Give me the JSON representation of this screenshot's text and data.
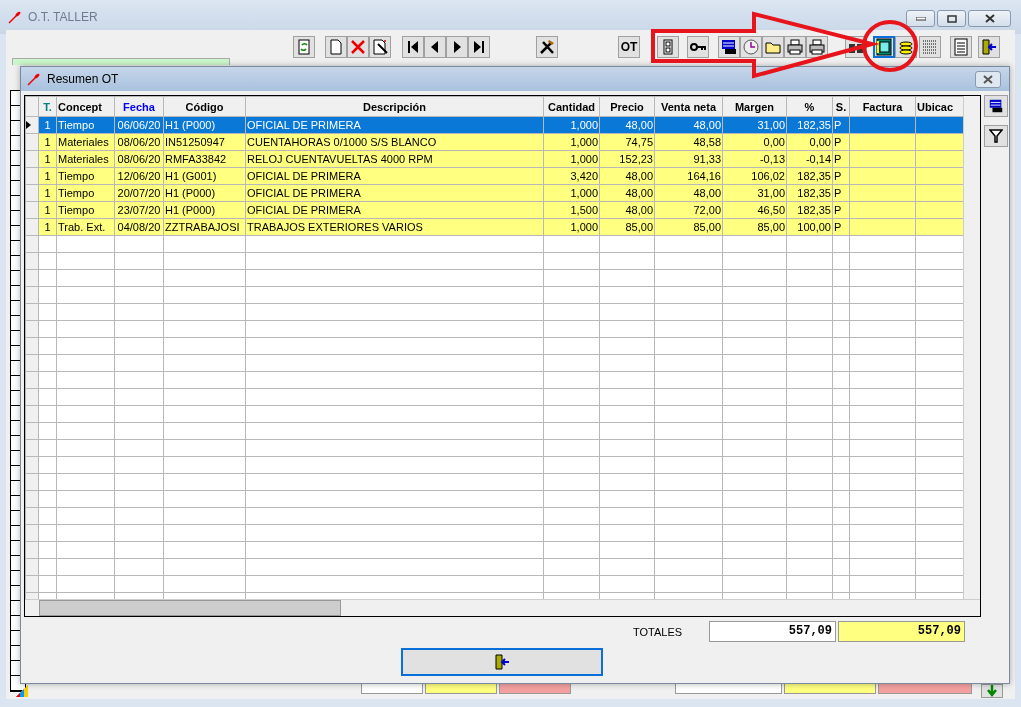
{
  "window": {
    "title": "O.T. TALLER"
  },
  "toolbar": [
    {
      "kind": "refresh",
      "selected": false
    },
    {
      "kind": "new",
      "selected": false
    },
    {
      "kind": "delete",
      "selected": false
    },
    {
      "kind": "wizard",
      "selected": false
    },
    {
      "kind": "first",
      "selected": false
    },
    {
      "kind": "prev",
      "selected": false
    },
    {
      "kind": "next",
      "selected": false
    },
    {
      "kind": "last",
      "selected": false
    },
    {
      "kind": "tools",
      "selected": false
    },
    {
      "kind": "text",
      "label": "OT",
      "selected": false
    },
    {
      "kind": "calc",
      "selected": false
    },
    {
      "kind": "key",
      "selected": false
    },
    {
      "kind": "calendar",
      "selected": false
    },
    {
      "kind": "clock",
      "selected": false
    },
    {
      "kind": "folder",
      "selected": false
    },
    {
      "kind": "printer",
      "selected": false
    },
    {
      "kind": "printer",
      "selected": false
    },
    {
      "kind": "binoculars",
      "selected": false
    },
    {
      "kind": "ledger",
      "selected": true
    },
    {
      "kind": "coins",
      "selected": false
    },
    {
      "kind": "grid",
      "selected": false
    },
    {
      "kind": "document",
      "selected": false
    },
    {
      "kind": "exit",
      "selected": false
    }
  ],
  "dialog": {
    "title": "Resumen OT",
    "columns": [
      {
        "label": "T.",
        "color": "#008080"
      },
      {
        "label": "Concept",
        "color": "#000000"
      },
      {
        "label": "Fecha",
        "color": "#0000ff"
      },
      {
        "label": "Código",
        "color": "#000000"
      },
      {
        "label": "Descripción",
        "color": "#000000"
      },
      {
        "label": "Cantidad",
        "color": "#000000"
      },
      {
        "label": "Precio",
        "color": "#000000"
      },
      {
        "label": "Venta neta",
        "color": "#000000"
      },
      {
        "label": "Margen",
        "color": "#000000"
      },
      {
        "label": "%",
        "color": "#000000"
      },
      {
        "label": "S.",
        "color": "#000000"
      },
      {
        "label": "Factura",
        "color": "#000000"
      },
      {
        "label": "Ubicac",
        "color": "#000000"
      }
    ],
    "rows": [
      {
        "selected": true,
        "cells": [
          "1",
          "Tiempo",
          "06/06/20",
          "H1 (P000)",
          "OFICIAL DE PRIMERA",
          "1,000",
          "48,00",
          "48,00",
          "31,00",
          "182,35",
          "P",
          "",
          ""
        ]
      },
      {
        "selected": false,
        "cells": [
          "1",
          "Materiales",
          "08/06/20",
          "IN51250947",
          "CUENTAHORAS 0/1000 S/S BLANCO",
          "1,000",
          "74,75",
          "48,58",
          "0,00",
          "0,00",
          "P",
          "",
          ""
        ]
      },
      {
        "selected": false,
        "cells": [
          "1",
          "Materiales",
          "08/06/20",
          "RMFA33842",
          "RELOJ CUENTAVUELTAS 4000 RPM",
          "1,000",
          "152,23",
          "91,33",
          "-0,13",
          "-0,14",
          "P",
          "",
          ""
        ]
      },
      {
        "selected": false,
        "cells": [
          "1",
          "Tiempo",
          "12/06/20",
          "H1 (G001)",
          "OFICIAL DE PRIMERA",
          "3,420",
          "48,00",
          "164,16",
          "106,02",
          "182,35",
          "P",
          "",
          ""
        ]
      },
      {
        "selected": false,
        "cells": [
          "1",
          "Tiempo",
          "20/07/20",
          "H1 (P000)",
          "OFICIAL DE PRIMERA",
          "1,000",
          "48,00",
          "48,00",
          "31,00",
          "182,35",
          "P",
          "",
          ""
        ]
      },
      {
        "selected": false,
        "cells": [
          "1",
          "Tiempo",
          "23/07/20",
          "H1 (P000)",
          "OFICIAL DE PRIMERA",
          "1,500",
          "48,00",
          "72,00",
          "46,50",
          "182,35",
          "P",
          "",
          ""
        ]
      },
      {
        "selected": false,
        "cells": [
          "1",
          "Trab. Ext.",
          "04/08/20",
          "ZZTRABAJOSI",
          "TRABAJOS EXTERIORES VARIOS",
          "1,000",
          "85,00",
          "85,00",
          "85,00",
          "100,00",
          "P",
          "",
          ""
        ]
      }
    ],
    "totals": {
      "label": "TOTALES",
      "value": "557,09",
      "value_highlighted": "557,09"
    }
  }
}
